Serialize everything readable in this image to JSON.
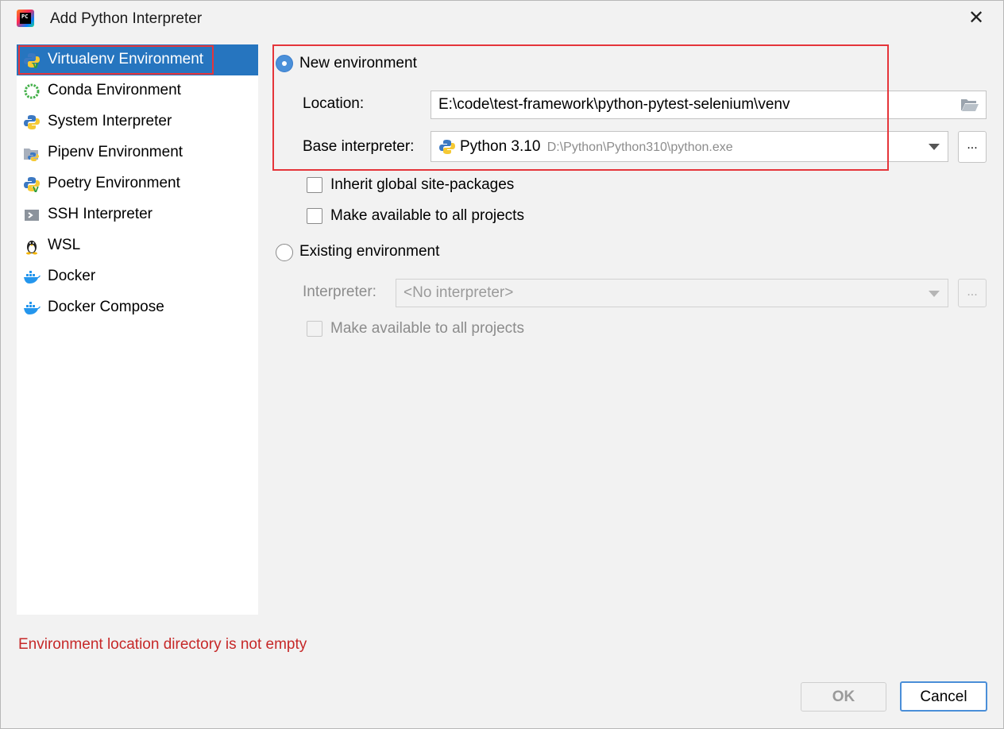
{
  "window": {
    "title": "Add Python Interpreter",
    "close_label": "✕"
  },
  "left_list": {
    "items": [
      {
        "label": "Virtualenv Environment",
        "icon": "python-virtualenv-icon",
        "selected": true
      },
      {
        "label": "Conda Environment",
        "icon": "conda-icon",
        "selected": false
      },
      {
        "label": "System Interpreter",
        "icon": "python-icon",
        "selected": false
      },
      {
        "label": "Pipenv Environment",
        "icon": "pipenv-icon",
        "selected": false
      },
      {
        "label": "Poetry Environment",
        "icon": "poetry-icon",
        "selected": false
      },
      {
        "label": "SSH Interpreter",
        "icon": "ssh-icon",
        "selected": false
      },
      {
        "label": "WSL",
        "icon": "linux-penguin-icon",
        "selected": false
      },
      {
        "label": "Docker",
        "icon": "docker-icon",
        "selected": false
      },
      {
        "label": "Docker Compose",
        "icon": "docker-compose-icon",
        "selected": false
      }
    ]
  },
  "new_env": {
    "radio_label": "New environment",
    "selected": true,
    "location_label": "Location:",
    "location_value": "E:\\code\\test-framework\\python-pytest-selenium\\venv",
    "base_label": "Base interpreter:",
    "base_name": "Python 3.10",
    "base_path": "D:\\Python\\Python310\\python.exe",
    "dots_label": "...",
    "inherit_label": "Inherit global site-packages",
    "make_available_label": "Make available to all projects"
  },
  "existing_env": {
    "radio_label": "Existing environment",
    "selected": false,
    "interpreter_label": "Interpreter:",
    "interpreter_value": "<No interpreter>",
    "dots_label": "...",
    "make_available_label": "Make available to all projects"
  },
  "error_message": "Environment location directory is not empty",
  "buttons": {
    "ok": "OK",
    "cancel": "Cancel"
  },
  "colors": {
    "selection": "#2675bf",
    "highlight_box": "#e5353a",
    "error": "#c62828",
    "focus": "#4a8ed8"
  }
}
